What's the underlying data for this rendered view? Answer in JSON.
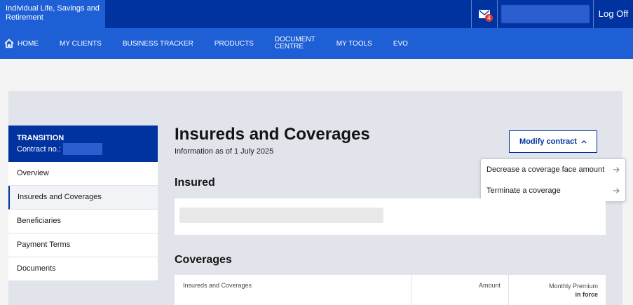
{
  "header": {
    "brand": "Individual Life, Savings and Retirement",
    "mail_badge_count": "4",
    "logoff_label": "Log Off"
  },
  "nav": {
    "items": [
      {
        "label": "HOME",
        "icon": "home-icon"
      },
      {
        "label": "MY CLIENTS"
      },
      {
        "label": "BUSINESS TRACKER"
      },
      {
        "label": "PRODUCTS"
      },
      {
        "label": "DOCUMENT",
        "label2": "CENTRE"
      },
      {
        "label": "MY TOOLS"
      },
      {
        "label": "EVO"
      }
    ]
  },
  "sidebar": {
    "title": "TRANSITION",
    "contract_label": "Contract no.:",
    "items": [
      {
        "label": "Overview"
      },
      {
        "label": "Insureds and Coverages",
        "active": true
      },
      {
        "label": "Beneficiaries"
      },
      {
        "label": "Payment Terms"
      },
      {
        "label": "Documents"
      }
    ]
  },
  "main": {
    "title": "Insureds and Coverages",
    "subtitle": "Information as of 1 July 2025",
    "modify_label": "Modify contract",
    "dropdown": [
      {
        "label": "Decrease a coverage face amount"
      },
      {
        "label": "Terminate a coverage"
      }
    ],
    "insured_title": "Insured",
    "coverages_title": "Coverages",
    "table_headers": {
      "col1": "Insureds and Coverages",
      "col2": "Amount",
      "col3_line1": "Monthly Premium",
      "col3_line2": "in force"
    }
  },
  "colors": {
    "primary_dark": "#0033a0",
    "primary": "#1f5fd6",
    "badge": "#e03a3a"
  }
}
